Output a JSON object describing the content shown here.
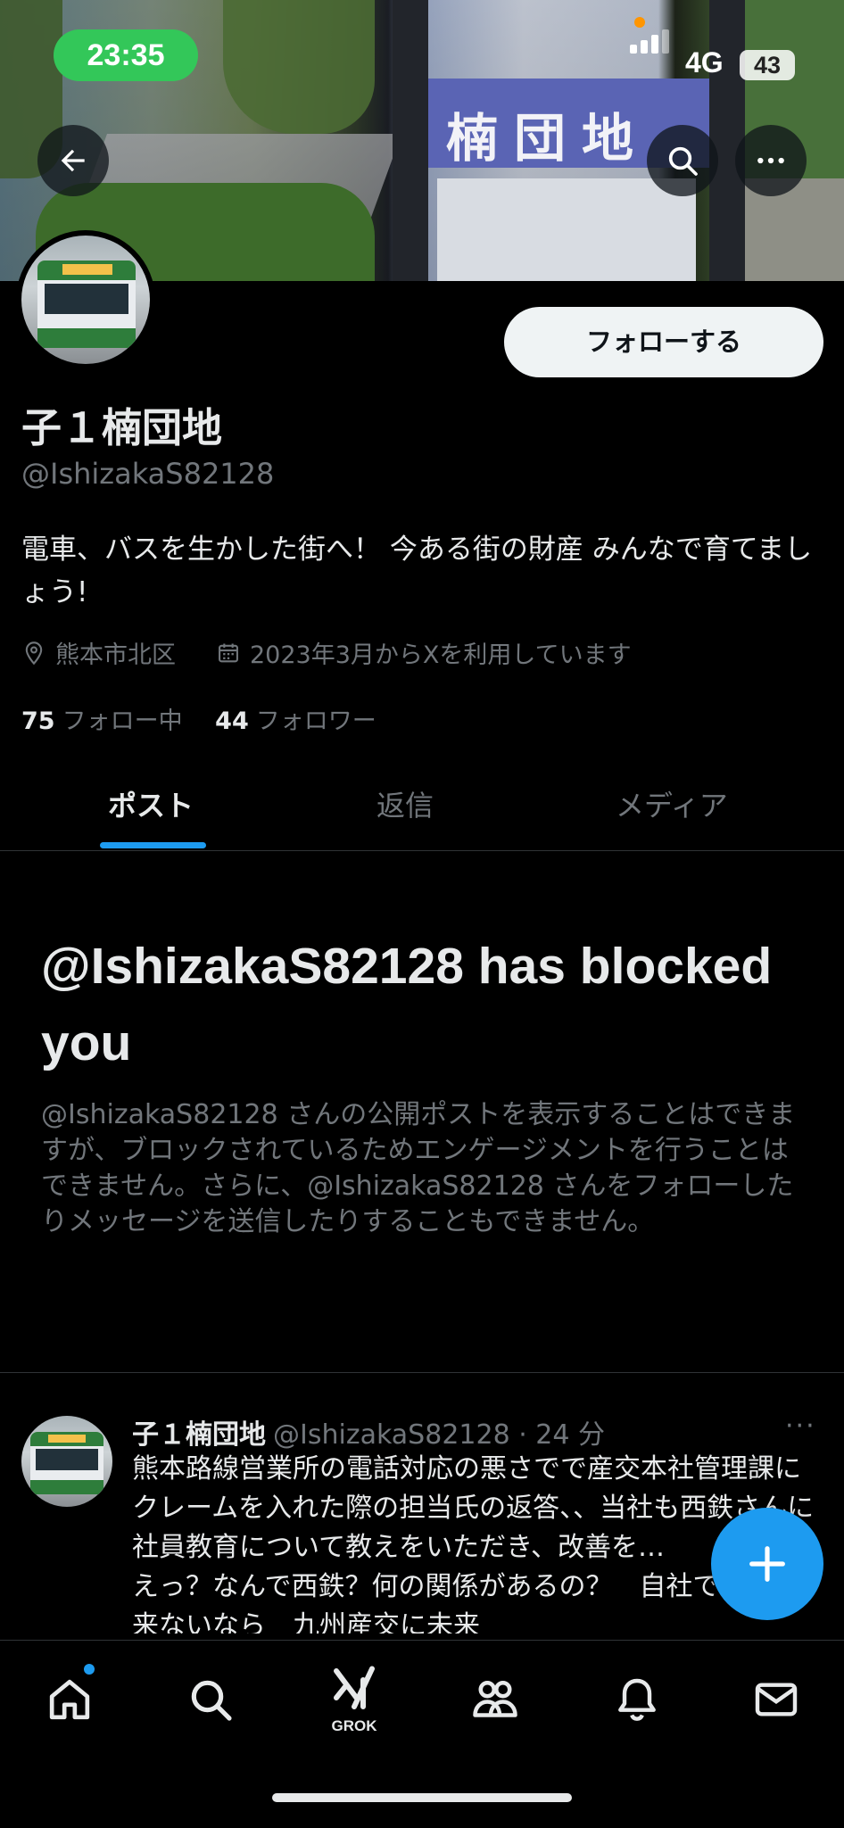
{
  "status_bar": {
    "time": "23:35",
    "network": "4G",
    "battery": "43"
  },
  "banner": {
    "sign_text": "楠団地"
  },
  "profile": {
    "display_name": "子１楠団地",
    "handle": "@IshizakaS82128",
    "follow_button": "フォローする",
    "bio": "電車、バスを生かした街へ！ 今ある街の財産 みんなで育てましょう!",
    "location": "熊本市北区",
    "joined": "2023年3月からXを利用しています",
    "following_count": "75",
    "following_label": "フォロー中",
    "followers_count": "44",
    "followers_label": "フォロワー"
  },
  "tabs": [
    {
      "label": "ポスト",
      "active": true
    },
    {
      "label": "返信",
      "active": false
    },
    {
      "label": "メディア",
      "active": false
    }
  ],
  "blocked_notice": {
    "title": "@IshizakaS82128 has blocked you",
    "description": "@IshizakaS82128 さんの公開ポストを表示することはできますが、ブロックされているためエンゲージメントを行うことはできません。さらに、@IshizakaS82128 さんをフォローしたりメッセージを送信したりすることもできません。"
  },
  "post": {
    "name": "子１楠団地",
    "handle_time": "@IshizakaS82128 · 24 分",
    "more": "···",
    "text": "熊本路線営業所の電話対応の悪さでで産交本社管理課にクレームを入れた際の担当氏の返答、、当社も西鉄さんに社員教育について教えをいただき、改善を…　　は？　えっ？なんで西鉄？何の関係があるの？　自社で教育出来ないなら　九州産交に未来"
  },
  "nav": {
    "grok_label": "GROK"
  },
  "colors": {
    "accent": "#1d9bf0",
    "background": "#000000",
    "secondary_text": "#71767b",
    "status_green": "#33c759"
  },
  "icons": [
    "back-arrow-icon",
    "search-icon",
    "more-icon",
    "location-pin-icon",
    "calendar-icon",
    "plus-icon",
    "home-icon",
    "grok-icon",
    "communities-icon",
    "bell-icon",
    "mail-icon"
  ]
}
